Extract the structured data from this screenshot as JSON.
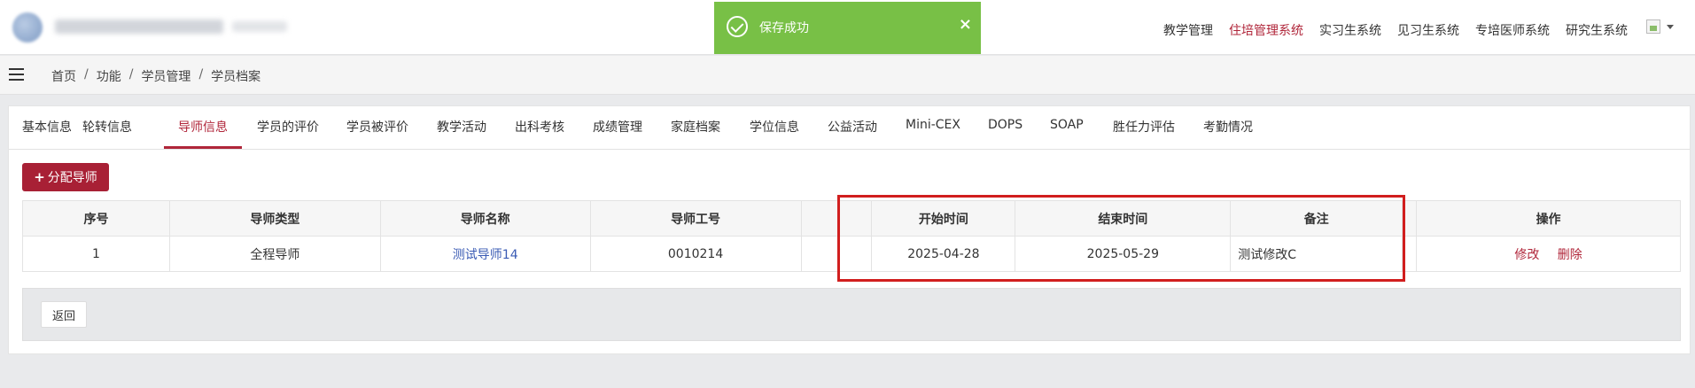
{
  "toast": {
    "message": "保存成功",
    "close": "×"
  },
  "topnav": [
    {
      "label": "教学管理",
      "active": false
    },
    {
      "label": "住培管理系统",
      "active": true
    },
    {
      "label": "实习生系统",
      "active": false
    },
    {
      "label": "见习生系统",
      "active": false
    },
    {
      "label": "专培医师系统",
      "active": false
    },
    {
      "label": "研究生系统",
      "active": false
    }
  ],
  "breadcrumb": [
    "首页",
    "功能",
    "学员管理",
    "学员档案"
  ],
  "breadcrumb_sep": "/",
  "tabs": [
    "基本信息",
    "轮转信息",
    "导师信息",
    "学员的评价",
    "学员被评价",
    "教学活动",
    "出科考核",
    "成绩管理",
    "家庭档案",
    "学位信息",
    "公益活动",
    "Mini-CEX",
    "DOPS",
    "SOAP",
    "胜任力评估",
    "考勤情况"
  ],
  "active_tab": "导师信息",
  "assign_button": {
    "icon": "+",
    "label": "分配导师"
  },
  "table": {
    "headers": [
      "序号",
      "导师类型",
      "导师名称",
      "导师工号",
      "",
      "开始时间",
      "结束时间",
      "备注",
      "",
      "操作"
    ],
    "rows": [
      {
        "index": "1",
        "type": "全程导师",
        "name": "测试导师14",
        "id": "0010214",
        "start": "2025-04-28",
        "end": "2025-05-29",
        "note": "测试修改C",
        "edit": "修改",
        "delete": "删除"
      }
    ]
  },
  "back_button": "返回",
  "colors": {
    "accent": "#b0263a",
    "toast": "#78c046",
    "link": "#3a5bb4",
    "highlight": "#d11e1e"
  }
}
